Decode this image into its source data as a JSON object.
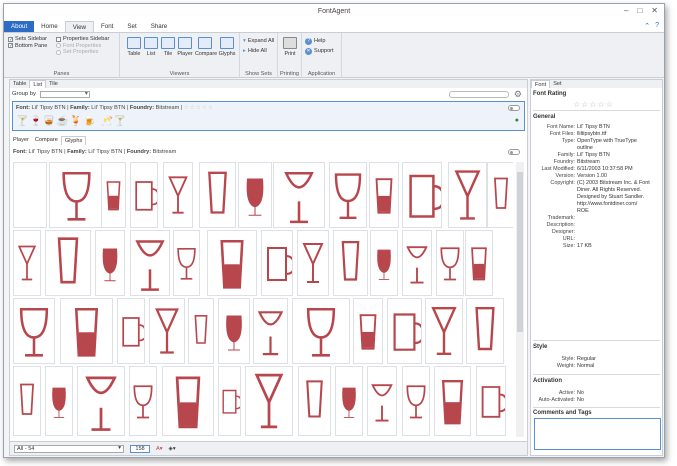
{
  "window": {
    "title": "FontAgent"
  },
  "tabs": [
    "About",
    "Home",
    "View",
    "Font",
    "Set",
    "Share"
  ],
  "active_tab": "View",
  "ribbon": {
    "panes": {
      "label": "Panes",
      "items": [
        {
          "label": "Sets Sidebar",
          "checked": true,
          "enabled": true
        },
        {
          "label": "Bottom Pane",
          "checked": true,
          "enabled": true
        },
        {
          "label": "Properties Sidebar",
          "checked": false,
          "enabled": true
        },
        {
          "label": "Font Properties",
          "checked": false,
          "enabled": false
        },
        {
          "label": "Set Properties",
          "checked": false,
          "enabled": false
        }
      ]
    },
    "viewers": {
      "label": "Viewers",
      "buttons": [
        "Table",
        "List",
        "Tile",
        "Player",
        "Compare",
        "Glyphs"
      ]
    },
    "show_sets": {
      "label": "Show Sets",
      "buttons": [
        "Expand All",
        "Hide All"
      ]
    },
    "printing": {
      "label": "Printing",
      "button": "Print"
    },
    "application": {
      "label": "Application",
      "buttons": [
        "Help",
        "Support"
      ]
    }
  },
  "view_tabs": [
    "Table",
    "List",
    "Tile"
  ],
  "active_view_tab": "List",
  "group_by": {
    "label": "Group by"
  },
  "font_card": {
    "font_label": "Font:",
    "font": "Lil' Tipsy BTN",
    "family_label": "Family:",
    "family": "Lil' Tipsy BTN",
    "foundry_label": "Foundry:",
    "foundry": "Bitstream",
    "stars": "☆☆☆☆☆",
    "preview": "🍸🍷🥃☕🍹🍺 🥂🍸"
  },
  "lower_tabs": [
    "Player",
    "Compare",
    "Glyphs"
  ],
  "active_lower_tab": "Glyphs",
  "glyph_header": {
    "font_label": "Font:",
    "font": "Lil' Tipsy BTN",
    "family_label": "Family:",
    "family": "Lil' Tipsy BTN",
    "foundry_label": "Foundry:",
    "foundry": "Bitstream"
  },
  "glyph_color": "#b8474d",
  "status": {
    "range": "All - 54",
    "size": "158"
  },
  "right_tabs": [
    "Font",
    "Set"
  ],
  "active_right_tab": "Font",
  "font_rating": {
    "title": "Font Rating",
    "stars": "☆☆☆☆☆"
  },
  "general": {
    "title": "General",
    "rows": [
      {
        "k": "Font Name:",
        "v": "Lil' Tipsy BTN"
      },
      {
        "k": "Font Files:",
        "v": "lliltipsybtn.ttf"
      },
      {
        "k": "Type:",
        "v": "OpenType with TrueType"
      },
      {
        "k": "",
        "v": "outline"
      },
      {
        "k": "Family:",
        "v": "Lil' Tipsy BTN"
      },
      {
        "k": "Foundry:",
        "v": "Bitstream"
      },
      {
        "k": "Last Modified:",
        "v": "6/11/2003 10:37:58 PM"
      },
      {
        "k": "Version:",
        "v": "Version 1.00"
      },
      {
        "k": "Copyright:",
        "v": "(C) 2003 Bitstream Inc. & Font"
      },
      {
        "k": "",
        "v": "Diner. All Rights Reserved."
      },
      {
        "k": "",
        "v": "Designed by Stuart Sandler."
      },
      {
        "k": "",
        "v": "http://www.fontdiner.com/"
      },
      {
        "k": "",
        "v": "ROE"
      },
      {
        "k": "Trademark:",
        "v": ""
      },
      {
        "k": "Description:",
        "v": ""
      },
      {
        "k": "Designer:",
        "v": ""
      },
      {
        "k": "URL:",
        "v": ""
      },
      {
        "k": "Size:",
        "v": "17 KB"
      }
    ]
  },
  "style": {
    "title": "Style",
    "rows": [
      {
        "k": "Style:",
        "v": "Regular"
      },
      {
        "k": "Weight:",
        "v": "Normal"
      }
    ]
  },
  "activation": {
    "title": "Activation",
    "rows": [
      {
        "k": "Active:",
        "v": "No"
      },
      {
        "k": "Auto-Activated:",
        "v": "No"
      }
    ]
  },
  "comments": {
    "title": "Comments and Tags"
  }
}
